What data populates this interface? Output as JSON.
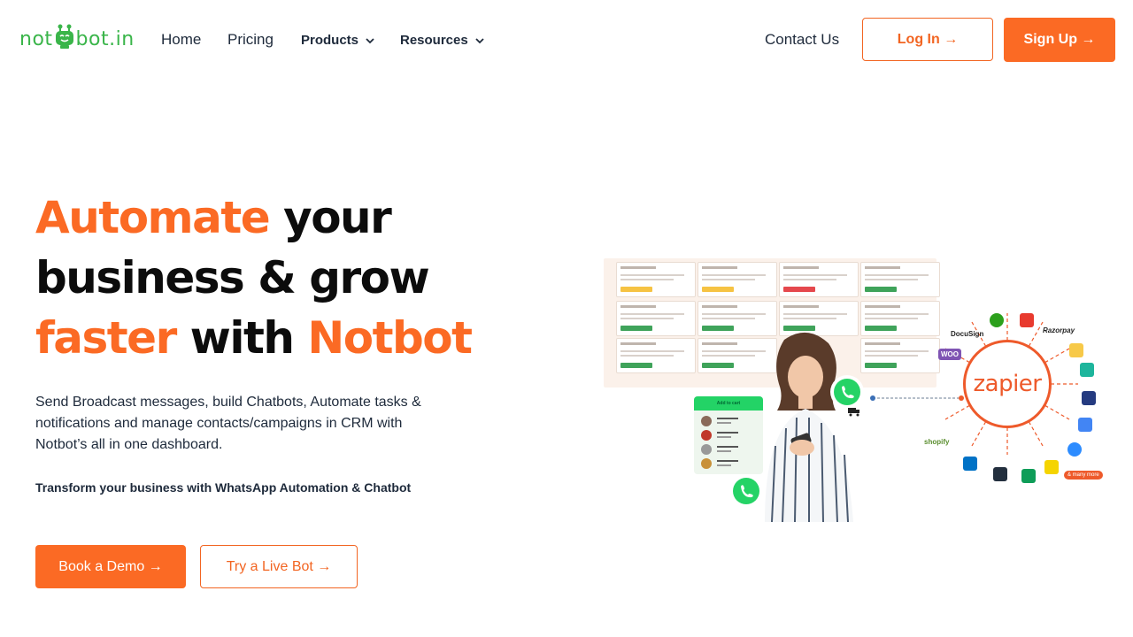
{
  "nav": {
    "logo_left": "not",
    "logo_right": "bot.in",
    "home": "Home",
    "pricing": "Pricing",
    "products": "Products",
    "resources": "Resources",
    "contact": "Contact Us",
    "login": "Log In →",
    "signup": "Sign Up →"
  },
  "hero": {
    "line1_accent": "Automate",
    "line1_rest": " your",
    "line2": "business & grow",
    "line3_accent": "faster",
    "line3_mid": " with ",
    "line3_brand": "Notbot",
    "description": "Send Broadcast messages, build Chatbots, Automate tasks & notifications and manage contacts/campaigns in CRM with Notbot’s all in one dashboard.",
    "subtext": "Transform your business with WhatsApp Automation & Chatbot",
    "demo_button": "Book a Demo →",
    "live_button": "Try a Live Bot →"
  },
  "illustration": {
    "cart_title": "Add to cart",
    "zapier_label": "zapier",
    "brands": [
      "DocuSign",
      "Razorpay",
      "WOO",
      "shopify",
      "& many more"
    ]
  },
  "colors": {
    "accent": "#fb6a24",
    "logo_green": "#3ab54a",
    "text_dark": "#1e2a3b"
  }
}
